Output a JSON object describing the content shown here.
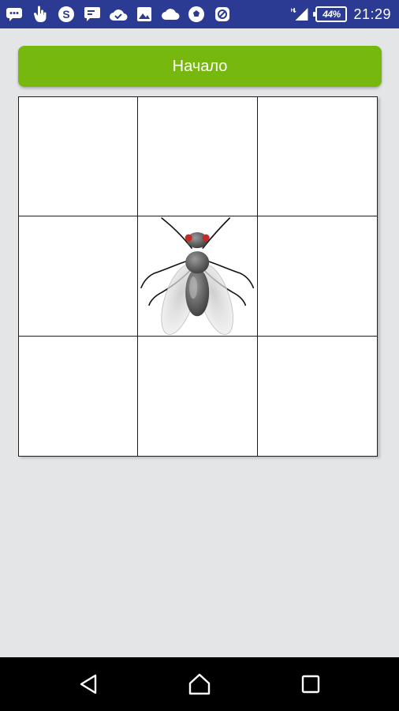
{
  "status_bar": {
    "icons": [
      "message-icon",
      "hand-icon",
      "skype-icon",
      "chat-icon",
      "cloud-check-icon",
      "image-icon",
      "cloud-icon",
      "soccer-icon",
      "app-icon"
    ],
    "signal_icon": "signal-icon",
    "battery_percent": "44%",
    "time": "21:29",
    "color": "#2b3a93"
  },
  "start_button": {
    "label": "Начало",
    "color": "#77b80f"
  },
  "board": {
    "rows": 3,
    "columns": 3,
    "fly_cell": {
      "row": 2,
      "column": 2
    },
    "fly_icon": "fly-icon"
  },
  "nav_bar": {
    "back_icon": "back-icon",
    "home_icon": "home-icon",
    "recents_icon": "recents-icon"
  }
}
